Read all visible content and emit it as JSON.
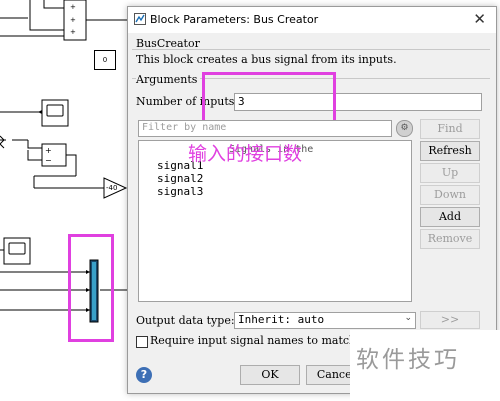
{
  "background": {
    "constant_value": "0",
    "gain_value": "-40"
  },
  "dialog": {
    "title": "Block Parameters: Bus Creator",
    "block_type": "BusCreator",
    "description": "This block creates a bus signal from its inputs.",
    "arguments_legend": "Arguments",
    "num_inputs_label": "Number of inputs:",
    "num_inputs_value": "3",
    "filter_placeholder": "Filter by name",
    "find_label": "Find",
    "refresh_label": "Refresh",
    "up_label": "Up",
    "down_label": "Down",
    "add_label": "Add",
    "remove_label": "Remove",
    "list_header": "Signals in the",
    "signals": [
      "signal1",
      "signal2",
      "signal3"
    ],
    "output_type_label": "Output data type:",
    "output_type_value": "Inherit: auto",
    "expand_label": ">>",
    "require_label": "Require input signal names to match s",
    "ok_label": "OK",
    "cancel_label": "Cancel"
  },
  "annotation": {
    "text": "输入的接口数",
    "color": "#e040e0"
  },
  "watermark": {
    "text": "软件技巧"
  }
}
